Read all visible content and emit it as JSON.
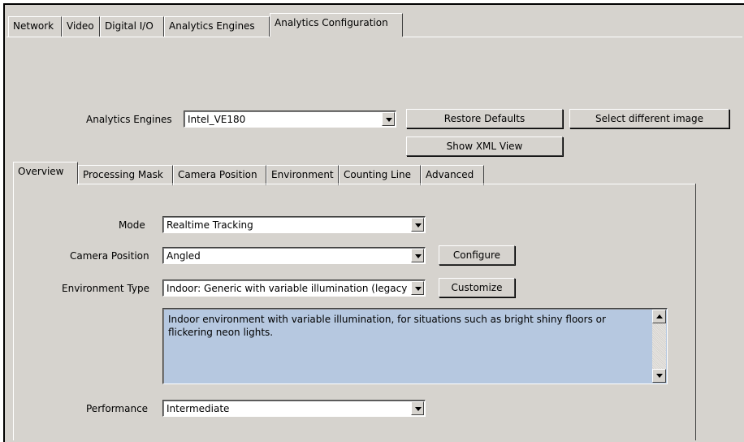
{
  "top_tabs": [
    {
      "label": "Network",
      "selected": false
    },
    {
      "label": "Video",
      "selected": false
    },
    {
      "label": "Digital I/O",
      "selected": false
    },
    {
      "label": "Analytics Engines",
      "selected": false
    },
    {
      "label": "Analytics Configuration",
      "selected": true
    }
  ],
  "engine_row": {
    "label": "Analytics Engines",
    "value": "Intel_VE180",
    "restore_defaults": "Restore Defaults",
    "select_image": "Select different image",
    "show_xml": "Show XML View"
  },
  "sub_tabs": [
    {
      "label": "Overview",
      "selected": true
    },
    {
      "label": "Processing Mask",
      "selected": false
    },
    {
      "label": "Camera Position",
      "selected": false
    },
    {
      "label": "Environment",
      "selected": false
    },
    {
      "label": "Counting Line",
      "selected": false
    },
    {
      "label": "Advanced",
      "selected": false
    }
  ],
  "overview": {
    "mode_label": "Mode",
    "mode_value": "Realtime Tracking",
    "camera_label": "Camera Position",
    "camera_value": "Angled",
    "configure_button": "Configure",
    "env_label": "Environment Type",
    "env_value": "Indoor: Generic with variable illumination (legacy",
    "customize_button": "Customize",
    "description": "Indoor environment with variable illumination, for situations such as bright shiny floors or flickering neon lights.",
    "perf_label": "Performance",
    "perf_value": "Intermediate"
  },
  "colors": {
    "panel": "#d6d3ce",
    "description_bg": "#b6c8e0"
  }
}
